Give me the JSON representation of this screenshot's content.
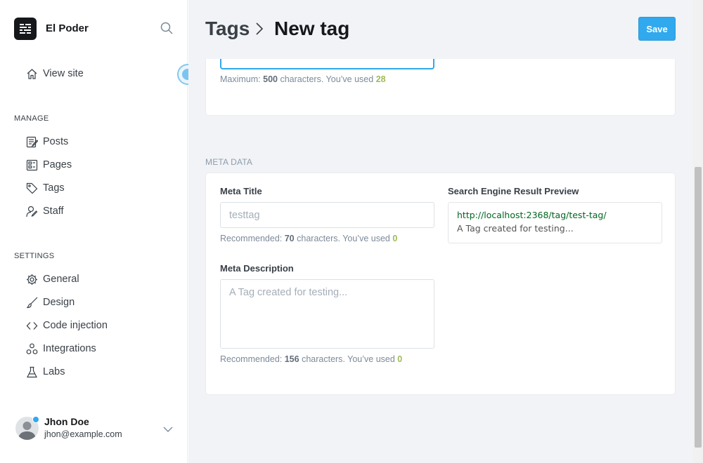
{
  "sidebar": {
    "brand": "El Poder",
    "view_site": "View site",
    "manage_header": "MANAGE",
    "manage_items": [
      {
        "label": "Posts",
        "icon": "posts-icon"
      },
      {
        "label": "Pages",
        "icon": "pages-icon"
      },
      {
        "label": "Tags",
        "icon": "tag-icon"
      },
      {
        "label": "Staff",
        "icon": "staff-icon"
      }
    ],
    "settings_header": "SETTINGS",
    "settings_items": [
      {
        "label": "General",
        "icon": "gear-icon"
      },
      {
        "label": "Design",
        "icon": "brush-icon"
      },
      {
        "label": "Code injection",
        "icon": "code-icon"
      },
      {
        "label": "Integrations",
        "icon": "integrations-icon"
      },
      {
        "label": "Labs",
        "icon": "flask-icon"
      }
    ],
    "user": {
      "name": "Jhon Doe",
      "email": "jhon@example.com"
    }
  },
  "header": {
    "breadcrumb_parent": "Tags",
    "breadcrumb_current": "New tag",
    "save_label": "Save"
  },
  "description_hint": {
    "prefix": "Maximum:",
    "max": "500",
    "middle": "characters. You’ve used",
    "used": "28"
  },
  "meta": {
    "section_title": "META DATA",
    "meta_title_label": "Meta Title",
    "meta_title_placeholder": "testtag",
    "meta_title_hint": {
      "prefix": "Recommended:",
      "max": "70",
      "middle": "characters. You’ve used",
      "used": "0"
    },
    "meta_description_label": "Meta Description",
    "meta_description_placeholder": "A Tag created for testing...",
    "meta_description_hint": {
      "prefix": "Recommended:",
      "max": "156",
      "middle": "characters. You’ve used",
      "used": "0"
    },
    "serp_label": "Search Engine Result Preview",
    "serp_url": "http://localhost:2368/tag/test-tag/",
    "serp_description": "A Tag created for testing..."
  },
  "colors": {
    "accent": "#30a9ee",
    "count_ok": "#9fbb58",
    "serp_url": "#006621"
  }
}
